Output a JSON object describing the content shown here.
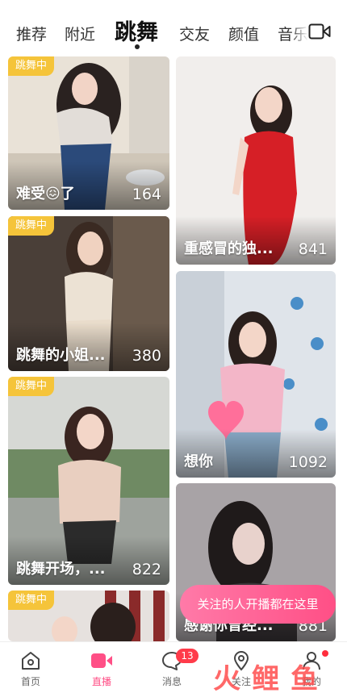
{
  "tabs": [
    {
      "label": "推荐",
      "active": false
    },
    {
      "label": "附近",
      "active": false
    },
    {
      "label": "跳舞",
      "active": true
    },
    {
      "label": "交友",
      "active": false
    },
    {
      "label": "颜值",
      "active": false
    },
    {
      "label": "音乐",
      "active": false
    }
  ],
  "header": {
    "camera_icon": "video-camera-icon"
  },
  "feed": {
    "live_badge": "跳舞中",
    "cards": [
      {
        "title": "难受😖了",
        "viewers": "164",
        "badge": true
      },
      {
        "title": "重感冒的独...",
        "viewers": "841",
        "badge": false
      },
      {
        "title": "跳舞的小姐...",
        "viewers": "380",
        "badge": true
      },
      {
        "title": "想你",
        "viewers": "1092",
        "badge": false
      },
      {
        "title": "跳舞开场，...",
        "viewers": "822",
        "badge": true
      },
      {
        "title": "感谢你曾经...",
        "viewers": "881",
        "badge": false
      },
      {
        "title": "",
        "viewers": "",
        "badge": true
      }
    ]
  },
  "followed_live_prompt": "关注的人开播都在这里",
  "bottom_nav": {
    "items": [
      {
        "label": "首页",
        "icon": "home-icon",
        "active": false
      },
      {
        "label": "直播",
        "icon": "live-camera-icon",
        "active": true
      },
      {
        "label": "消息",
        "icon": "message-icon",
        "active": false,
        "badge": "13"
      },
      {
        "label": "关注",
        "icon": "location-icon",
        "active": false
      },
      {
        "label": "我的",
        "icon": "profile-icon",
        "active": false
      }
    ]
  },
  "watermark": "火鲤鱼",
  "colors": {
    "accent": "#ff4f86",
    "badge": "#f5c43a",
    "notify": "#ff3b4a"
  }
}
